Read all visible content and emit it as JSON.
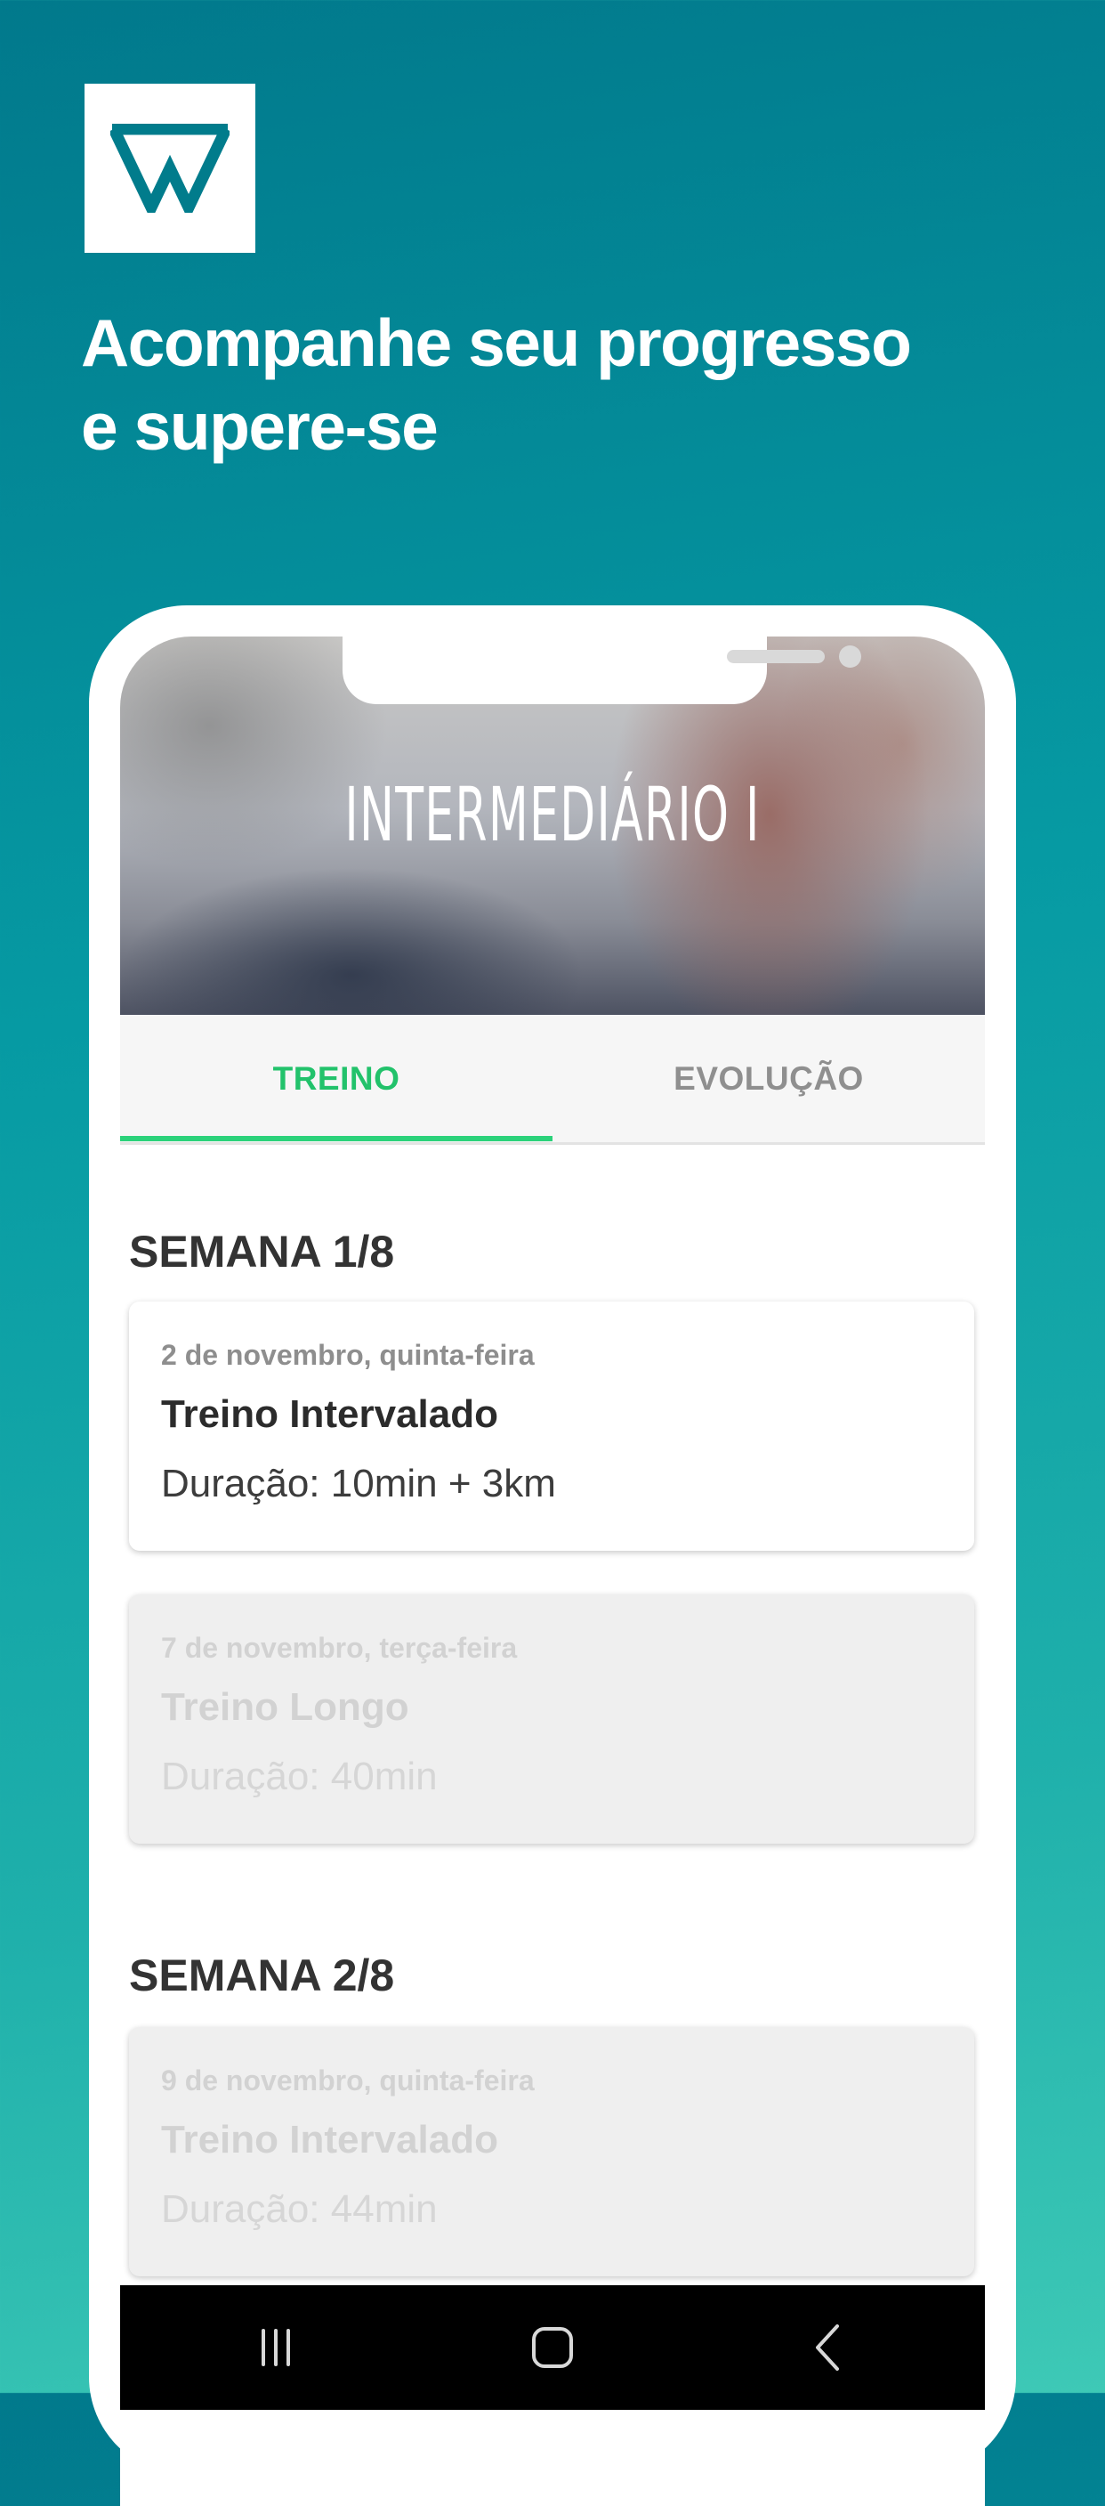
{
  "brand": {
    "logo_icon": "w-logo-icon",
    "logo_color": "#017c8c"
  },
  "headline": {
    "line1": "Acompanhe seu progresso",
    "line2": "e supere-se"
  },
  "app": {
    "hero_title": "INTERMEDIÁRIO I",
    "tabs": [
      {
        "label": "TREINO",
        "active": true
      },
      {
        "label": "EVOLUÇÃO",
        "active": false
      }
    ],
    "accent_color": "#22c26b",
    "weeks": [
      {
        "title": "SEMANA 1/8",
        "cards": [
          {
            "date": "2 de novembro, quinta-feira",
            "name": "Treino Intervalado",
            "duration": "Duração: 10min + 3km",
            "enabled": true
          },
          {
            "date": "7 de novembro, terça-feira",
            "name": "Treino Longo",
            "duration": "Duração: 40min",
            "enabled": false
          }
        ]
      },
      {
        "title": "SEMANA 2/8",
        "cards": [
          {
            "date": "9 de novembro, quinta-feira",
            "name": "Treino Intervalado",
            "duration": "Duração: 44min",
            "enabled": false
          }
        ]
      }
    ]
  },
  "navbar": {
    "buttons": [
      "recents-icon",
      "home-icon",
      "back-icon"
    ]
  }
}
